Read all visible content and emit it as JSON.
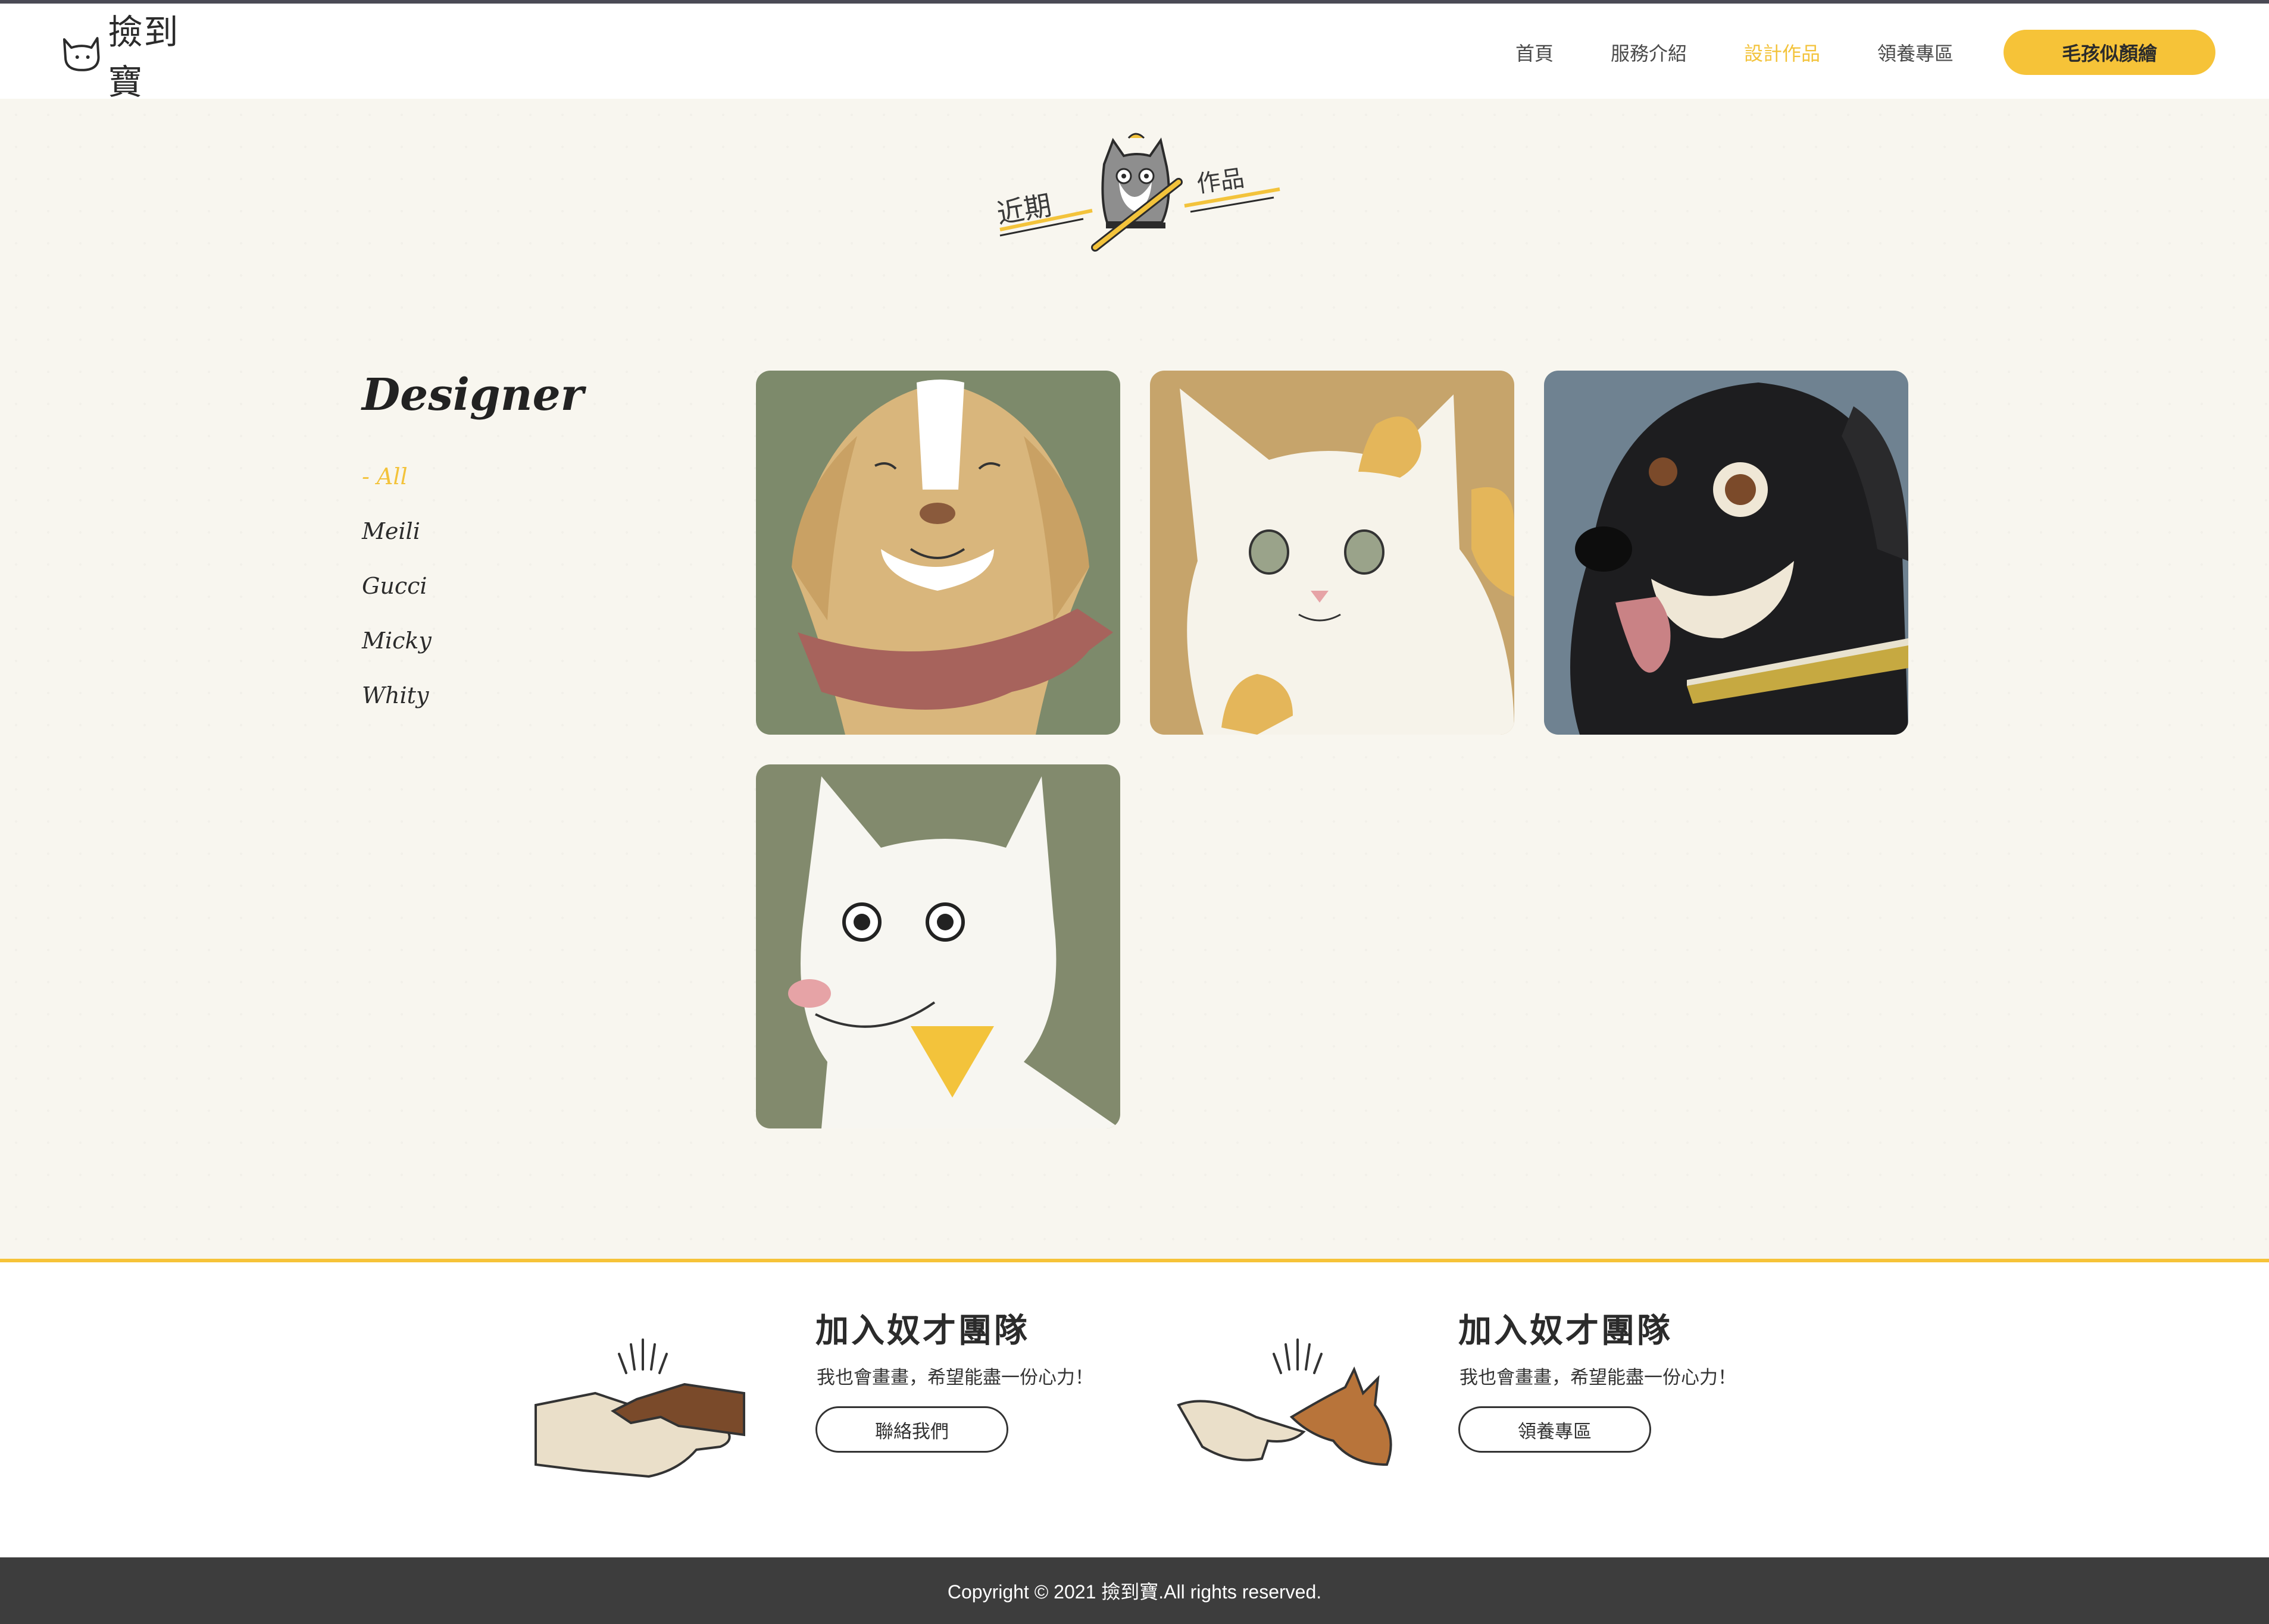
{
  "brand": {
    "name": "撿到寶"
  },
  "nav": {
    "items": [
      {
        "label": "首頁"
      },
      {
        "label": "服務介紹"
      },
      {
        "label": "設計作品"
      },
      {
        "label": "領養專區"
      }
    ],
    "active_index": 2,
    "cta_label": "毛孩似顏繪"
  },
  "section": {
    "title_left": "近期",
    "title_right": "作品"
  },
  "sidebar": {
    "heading": "Designer",
    "filters": [
      {
        "label": "- All"
      },
      {
        "label": "Meili"
      },
      {
        "label": "Gucci"
      },
      {
        "label": "Micky"
      },
      {
        "label": "Whity"
      }
    ],
    "active_index": 0
  },
  "gallery": {
    "items": [
      {
        "name": "Meili",
        "subject": "golden-dog-with-red-bandana",
        "bg": "#7d8a6b"
      },
      {
        "name": "Gucci",
        "subject": "white-orange-cat",
        "bg": "#c6a46b"
      },
      {
        "name": "Micky",
        "subject": "black-dog-tongue-out",
        "bg": "#6f8291"
      },
      {
        "name": "Whity",
        "subject": "white-dog-yellow-scarf",
        "bg": "#828a6d"
      }
    ]
  },
  "join": [
    {
      "title": "加入奴才團隊",
      "subtitle": "我也會畫畫，希望能盡一份心力！",
      "button": "聯絡我們",
      "icon": "handshake-icon"
    },
    {
      "title": "加入奴才團隊",
      "subtitle": "我也會畫畫，希望能盡一份心力！",
      "button": "領養專區",
      "icon": "hand-dog-icon"
    }
  ],
  "footer": {
    "copyright": "Copyright © 2021 撿到寶.All rights reserved."
  },
  "colors": {
    "accent": "#f6c338",
    "footer_bg": "#3d3d3d",
    "page_bg": "#f8f6ef"
  }
}
